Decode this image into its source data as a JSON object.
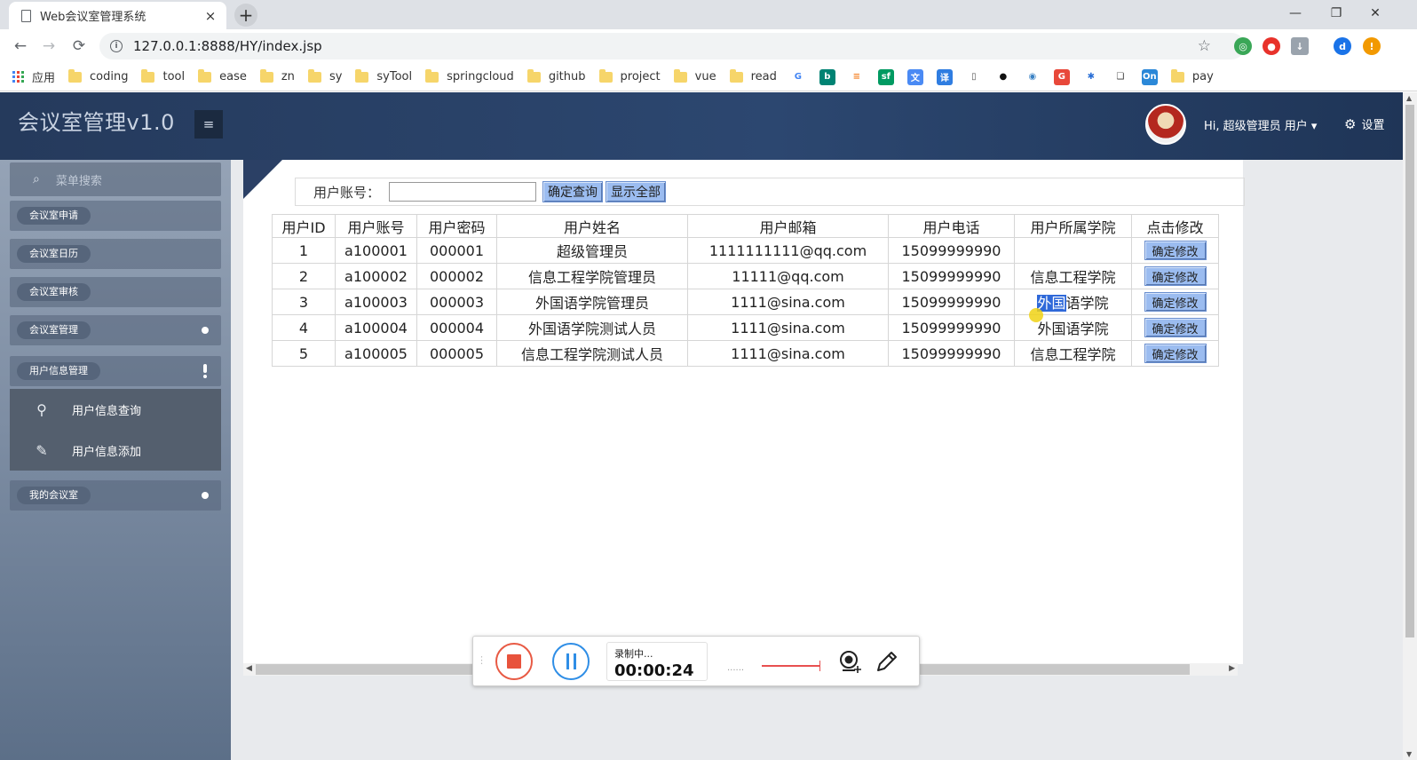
{
  "browser": {
    "tab_title": "Web会议室管理系统",
    "tab_close": "×",
    "new_tab": "+",
    "url": "127.0.0.1:8888/HY/index.jsp",
    "window_controls": {
      "minimize": "—",
      "restore": "❐",
      "close": "✕"
    },
    "nav": {
      "back": "←",
      "forward": "→",
      "reload": "⟳"
    },
    "profile_initial": "d",
    "bookmarks": [
      "应用",
      "coding",
      "tool",
      "ease",
      "zn",
      "sy",
      "syTool",
      "springcloud",
      "github",
      "project",
      "vue",
      "read",
      "pay"
    ],
    "bookmark_icons": [
      {
        "name": "google-icon",
        "glyph": "G",
        "color": "#ffffff",
        "fg": "#4285f4"
      },
      {
        "name": "bing-icon",
        "glyph": "b",
        "color": "#008373",
        "fg": "#ffffff"
      },
      {
        "name": "stackoverflow-icon",
        "glyph": "≡",
        "color": "#ffffff",
        "fg": "#f48024"
      },
      {
        "name": "segmentfault-icon",
        "glyph": "sf",
        "color": "#009a61",
        "fg": "#ffffff"
      },
      {
        "name": "translate-icon",
        "glyph": "文",
        "color": "#4a8af4",
        "fg": "#ffffff"
      },
      {
        "name": "youdao-translate-icon",
        "glyph": "译",
        "color": "#2f7de1",
        "fg": "#ffffff"
      },
      {
        "name": "page-icon",
        "glyph": "▯",
        "color": "#ffffff",
        "fg": "#555555"
      },
      {
        "name": "github-icon",
        "glyph": "●",
        "color": "#ffffff",
        "fg": "#111111"
      },
      {
        "name": "globe-icon",
        "glyph": "◉",
        "color": "#ffffff",
        "fg": "#3b82c4"
      },
      {
        "name": "gitee-icon",
        "glyph": "G",
        "color": "#e8483a",
        "fg": "#ffffff"
      },
      {
        "name": "gear-bookmark-icon",
        "glyph": "✱",
        "color": "#ffffff",
        "fg": "#2a6fd6"
      },
      {
        "name": "book-icon",
        "glyph": "❏",
        "color": "#ffffff",
        "fg": "#333333"
      },
      {
        "name": "onenote-icon",
        "glyph": "On",
        "color": "#2b88d8",
        "fg": "#ffffff"
      }
    ]
  },
  "app": {
    "title": "会议室管理v1.0",
    "menu_toggle": "≡",
    "user_greeting": "Hi, 超级管理员 用户 ▾",
    "settings_label": "设置"
  },
  "sidebar": {
    "search_placeholder": "菜单搜索",
    "items": [
      {
        "label": "会议室申请",
        "indicator": "none"
      },
      {
        "label": "会议室日历",
        "indicator": "none"
      },
      {
        "label": "会议室审核",
        "indicator": "none"
      },
      {
        "label": "会议室管理",
        "indicator": "dot"
      },
      {
        "label": "用户信息管理",
        "indicator": "exclaim"
      }
    ],
    "subitems": [
      {
        "label": "用户信息查询",
        "icon": "search-icon"
      },
      {
        "label": "用户信息添加",
        "icon": "edit-icon"
      }
    ],
    "last_item": {
      "label": "我的会议室",
      "indicator": "dot"
    }
  },
  "search": {
    "label": "用户账号：",
    "value": "",
    "query_button": "确定查询",
    "show_all_button": "显示全部"
  },
  "table": {
    "columns": [
      "用户ID",
      "用户账号",
      "用户密码",
      "用户姓名",
      "用户邮箱",
      "用户电话",
      "用户所属学院",
      "点击修改"
    ],
    "rows": [
      {
        "id": "1",
        "account": "a100001",
        "password": "000001",
        "name": "超级管理员",
        "email": "1111111111@qq.com",
        "phone": "15099999990",
        "college": "",
        "action": "确定修改"
      },
      {
        "id": "2",
        "account": "a100002",
        "password": "000002",
        "name": "信息工程学院管理员",
        "email": "11111@qq.com",
        "phone": "15099999990",
        "college": "信息工程学院",
        "action": "确定修改"
      },
      {
        "id": "3",
        "account": "a100003",
        "password": "000003",
        "name": "外国语学院管理员",
        "email": "1111@sina.com",
        "phone": "15099999990",
        "college": "外国语学院",
        "action": "确定修改"
      },
      {
        "id": "4",
        "account": "a100004",
        "password": "000004",
        "name": "外国语学院测试人员",
        "email": "1111@sina.com",
        "phone": "15099999990",
        "college": "外国语学院",
        "action": "确定修改"
      },
      {
        "id": "5",
        "account": "a100005",
        "password": "000005",
        "name": "信息工程学院测试人员",
        "email": "1111@sina.com",
        "phone": "15099999990",
        "college": "信息工程学院",
        "action": "确定修改"
      }
    ],
    "selected_text": {
      "row": 2,
      "text": "外国"
    }
  },
  "recorder": {
    "status": "录制中...",
    "elapsed": "00:00:24",
    "dots": "......"
  }
}
